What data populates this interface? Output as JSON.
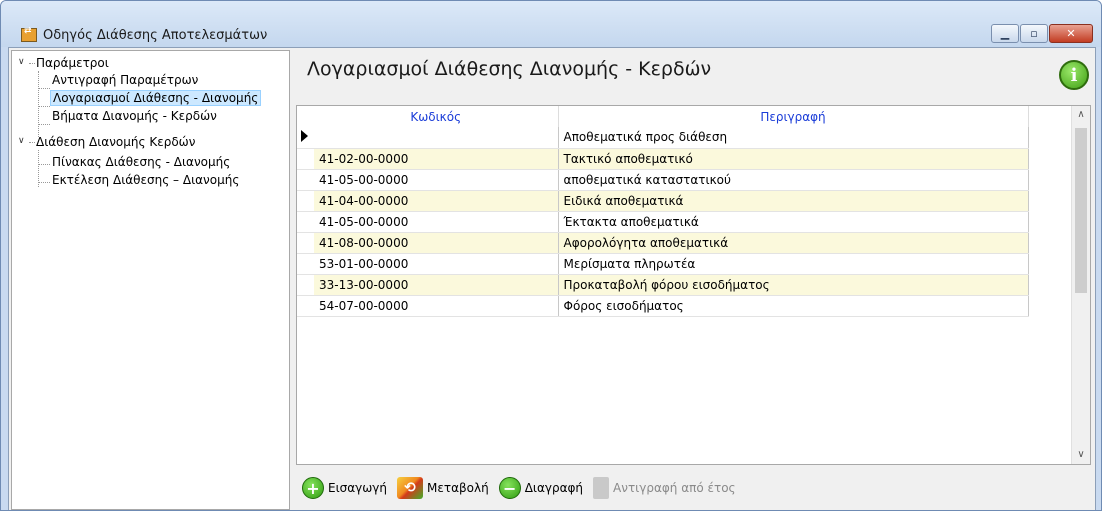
{
  "window": {
    "title": "Οδηγός Διάθεσης Αποτελεσμάτων",
    "minimize_icon": "minimize-icon",
    "maximize_icon": "maximize-icon",
    "close_icon": "close-icon"
  },
  "tree": {
    "groups": [
      {
        "label": "Παράμετροι",
        "children": [
          "Αντιγραφή Παραμέτρων",
          "Λογαριασμοί Διάθεσης - Διανομής",
          "Βήματα Διανομής - Κερδών"
        ]
      },
      {
        "label": "Διάθεση Διανομής Κερδών",
        "children": [
          "Πίνακας Διάθεσης - Διανομής",
          "Εκτέλεση Διάθεσης – Διανομής"
        ]
      }
    ],
    "selected": "Λογαριασμοί Διάθεσης - Διανομής"
  },
  "main": {
    "title": "Λογαριασμοί Διάθεσης Διανομής - Κερδών",
    "info_icon": "i"
  },
  "grid": {
    "columns": [
      "Κωδικός",
      "Περιγραφή"
    ],
    "rows": [
      {
        "code": "",
        "desc": "Αποθεματικά προς διάθεση"
      },
      {
        "code": "41-02-00-0000",
        "desc": "Τακτικό αποθεματικό"
      },
      {
        "code": "41-05-00-0000",
        "desc": "αποθεματικά καταστατικού"
      },
      {
        "code": "41-04-00-0000",
        "desc": "Ειδικά αποθεματικά"
      },
      {
        "code": "41-05-00-0000",
        "desc": "Έκτακτα αποθεματικά"
      },
      {
        "code": "41-08-00-0000",
        "desc": "Αφορολόγητα αποθεματικά"
      },
      {
        "code": "53-01-00-0000",
        "desc": "Μερίσματα πληρωτέα"
      },
      {
        "code": "33-13-00-0000",
        "desc": "Προκαταβολή φόρου εισοδήματος"
      },
      {
        "code": "54-07-00-0000",
        "desc": "Φόρος εισοδήματος"
      }
    ]
  },
  "toolbar": {
    "insert": "Εισαγωγή",
    "modify": "Μεταβολή",
    "delete": "Διαγραφή",
    "copy_from_year": "Αντιγραφή από έτος"
  },
  "colors": {
    "header_text": "#1a3cd8",
    "alt_row": "#fbf9dc",
    "selection": "#cce8ff"
  }
}
